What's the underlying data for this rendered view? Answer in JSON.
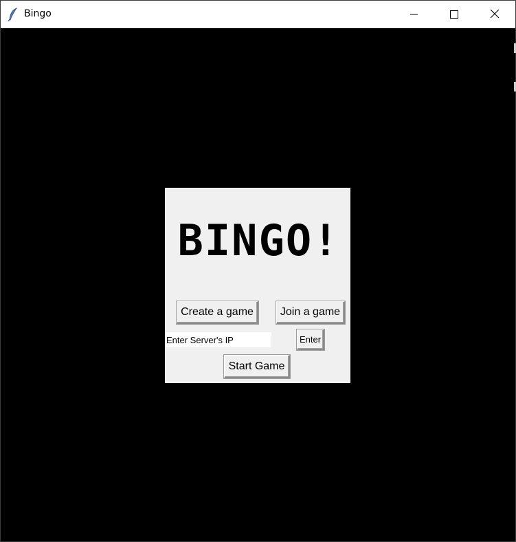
{
  "window": {
    "title": "Bingo",
    "icon": "feather-icon"
  },
  "controls": {
    "minimize_icon": "minimize-icon",
    "maximize_icon": "maximize-icon",
    "close_icon": "close-icon"
  },
  "panel": {
    "heading": "BINGO!",
    "create_button": "Create a game",
    "join_button": "Join a game",
    "ip_input_value": "Enter Server's IP",
    "enter_button": "Enter",
    "start_button": "Start Game"
  },
  "colors": {
    "background": "#000000",
    "panel": "#f0f0f0",
    "titlebar": "#ffffff"
  }
}
